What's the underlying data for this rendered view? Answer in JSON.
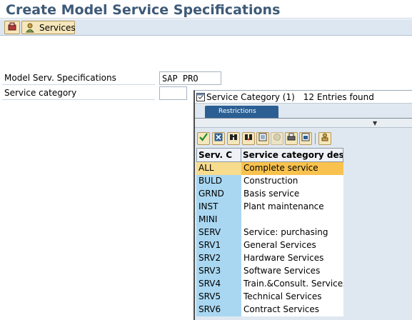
{
  "window": {
    "title": "Create Model Service Specifications"
  },
  "toolbar": {
    "services_label": "Services"
  },
  "form": {
    "model_spec_label": "Model Serv. Specifications",
    "model_spec_value": "SAP PRO",
    "service_category_label": "Service category",
    "service_category_value": ""
  },
  "popup": {
    "title": "Service Category (1)",
    "entries_found": "12 Entries found",
    "tab_label": "Restrictions",
    "columns": {
      "code": "Serv. C",
      "description": "Service category des"
    },
    "rows": [
      {
        "code": "ALL",
        "description": "Complete service",
        "selected": true
      },
      {
        "code": "BULD",
        "description": "Construction"
      },
      {
        "code": "GRND",
        "description": "Basis service"
      },
      {
        "code": "INST",
        "description": "Plant maintenance"
      },
      {
        "code": "MINI",
        "description": ""
      },
      {
        "code": "SERV",
        "description": "Service: purchasing"
      },
      {
        "code": "SRV1",
        "description": "General Services"
      },
      {
        "code": "SRV2",
        "description": "Hardware Services"
      },
      {
        "code": "SRV3",
        "description": "Software Services"
      },
      {
        "code": "SRV4",
        "description": "Train.&Consult. Services"
      },
      {
        "code": "SRV5",
        "description": "Technical Services"
      },
      {
        "code": "SRV6",
        "description": "Contract Services"
      }
    ]
  },
  "colors": {
    "title_text": "#3e5a78",
    "toolbar_bg": "#dde7f1",
    "button_bg": "#f5e7bb",
    "tab_bg": "#2b5f94",
    "key_column_bg": "#a9d7f2",
    "selected_row_bg": "#f9c24e"
  },
  "icons": {
    "other_object": "other-object-icon",
    "services": "services-icon",
    "popup_title": "value-help-icon",
    "toolbar": [
      "continue-icon",
      "cancel-icon",
      "find-icon",
      "find-next-icon",
      "sort-icon",
      "disabled-icon",
      "print-icon",
      "filter-icon",
      "personal-list-icon"
    ]
  }
}
